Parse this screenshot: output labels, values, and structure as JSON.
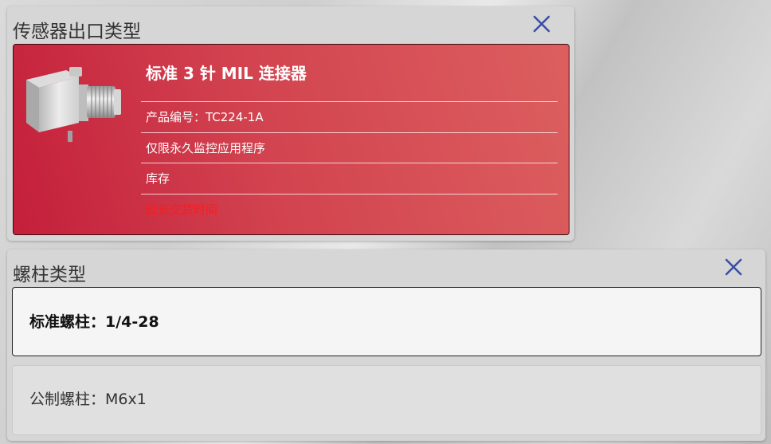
{
  "output_panel": {
    "title": "传感器出口类型",
    "close_icon": "close-icon",
    "product": {
      "name": "标准 3 针 MIL 连接器",
      "specs": [
        {
          "text": "产品编号：TC224-1A"
        },
        {
          "text": "仅限永久监控应用程序"
        },
        {
          "text": "库存"
        },
        {
          "text": "延长交货时间",
          "color": "#ff1a1a"
        }
      ]
    }
  },
  "stud_panel": {
    "title": "螺柱类型",
    "close_icon": "close-icon",
    "options": [
      {
        "label": "标准螺柱：1/4-28",
        "selected": true
      },
      {
        "label": "公制螺柱：M6x1",
        "selected": false
      }
    ]
  },
  "colors": {
    "accent_close": "#3b4fa8",
    "card_red": "#c41f3b",
    "alert_red": "#ff1a1a"
  }
}
